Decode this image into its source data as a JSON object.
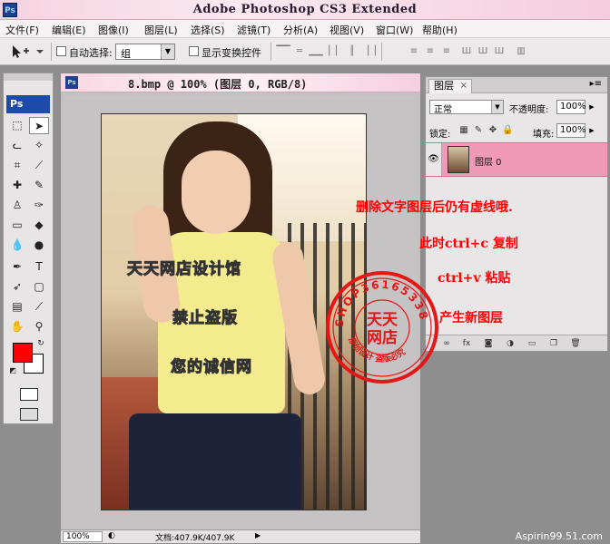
{
  "window": {
    "app_icon": "Ps",
    "title": "Adobe Photoshop CS3 Extended"
  },
  "menu": {
    "items": [
      "文件(F)",
      "编辑(E)",
      "图像(I)",
      "图层(L)",
      "选择(S)",
      "滤镜(T)",
      "分析(A)",
      "视图(V)",
      "窗口(W)",
      "帮助(H)"
    ]
  },
  "options": {
    "tool_icon": "move-tool-icon",
    "auto_select_label": "自动选择:",
    "auto_select_value": "组",
    "show_transform_label": "显示变换控件"
  },
  "toolbox": {
    "ps_label": "Ps",
    "foreground_color": "#ff0000",
    "background_color": "#ffffff"
  },
  "document": {
    "icon": "Ps",
    "title": "8.bmp @ 100% (图层 0, RGB/8)",
    "zoom": "100%",
    "status": "文档:407.9K/407.9K",
    "watermark_lines": [
      "天天网店设计馆",
      "禁止盗版",
      "您的诚信网"
    ]
  },
  "layers_panel": {
    "tab_label": "图层",
    "tab_close": "×",
    "blend_mode": "正常",
    "opacity_label": "不透明度:",
    "opacity_value": "100%",
    "lock_label": "锁定:",
    "fill_label": "填充:",
    "fill_value": "100%",
    "layer_name": "图层 0"
  },
  "annotations": {
    "line1": "删除文字图层后仍有虚线哦.",
    "line2": "此时ctrl+c 复制",
    "line3": "ctrl+v 粘贴",
    "line4": "产生新图层"
  },
  "seal": {
    "ring_text": "SHOP36165338",
    "center_top": "天天",
    "center_bottom": "网店",
    "bottom_text": "原创设计 盗版必究"
  },
  "footer": {
    "site_credit": "Aspirin99.51.com"
  }
}
